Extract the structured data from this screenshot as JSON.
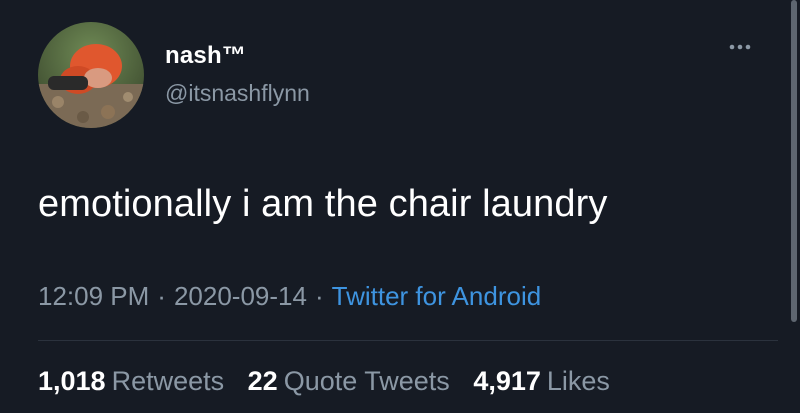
{
  "author": {
    "display_name": "nash™",
    "handle": "@itsnashflynn"
  },
  "tweet": {
    "text": "emotionally i am the chair laundry",
    "time": "12:09 PM",
    "date": "2020-09-14",
    "separator": "·",
    "source": "Twitter for Android"
  },
  "stats": {
    "retweets_count": "1,018",
    "retweets_label": "Retweets",
    "quotes_count": "22",
    "quotes_label": "Quote Tweets",
    "likes_count": "4,917",
    "likes_label": "Likes"
  },
  "icons": {
    "more": "more-options-icon",
    "avatar": "profile-photo"
  },
  "colors": {
    "background": "#161b24",
    "text_primary": "#ffffff",
    "text_secondary": "#8b98a5",
    "link": "#3e94e0"
  }
}
